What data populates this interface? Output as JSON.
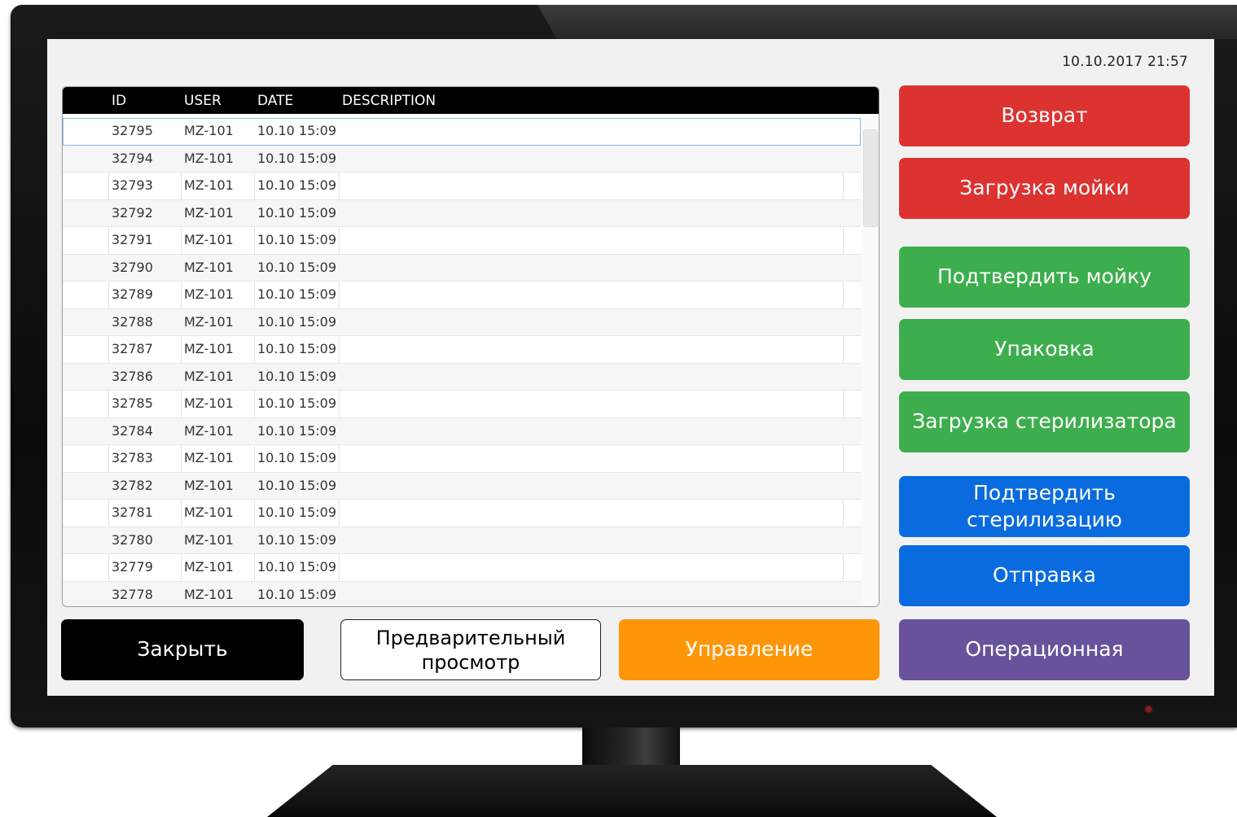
{
  "colors": {
    "return": "#dc3330",
    "green_actions": "#3dae4d",
    "blue_actions": "#0a6be0",
    "operating_room": "#67529b",
    "close": "#000000",
    "management": "#ff960a",
    "preview": "#ffffff"
  },
  "header": {
    "datetime": "10.10.2017 21:57"
  },
  "table": {
    "columns": [
      "ID",
      "USER",
      "DATE",
      "DESCRIPTION"
    ],
    "rows": [
      {
        "id": "32795",
        "user": "MZ-101",
        "date": "10.10 15:09",
        "description": ""
      },
      {
        "id": "32794",
        "user": "MZ-101",
        "date": "10.10 15:09",
        "description": ""
      },
      {
        "id": "32793",
        "user": "MZ-101",
        "date": "10.10 15:09",
        "description": ""
      },
      {
        "id": "32792",
        "user": "MZ-101",
        "date": "10.10 15:09",
        "description": ""
      },
      {
        "id": "32791",
        "user": "MZ-101",
        "date": "10.10 15:09",
        "description": ""
      },
      {
        "id": "32790",
        "user": "MZ-101",
        "date": "10.10 15:09",
        "description": ""
      },
      {
        "id": "32789",
        "user": "MZ-101",
        "date": "10.10 15:09",
        "description": ""
      },
      {
        "id": "32788",
        "user": "MZ-101",
        "date": "10.10 15:09",
        "description": ""
      },
      {
        "id": "32787",
        "user": "MZ-101",
        "date": "10.10 15:09",
        "description": ""
      },
      {
        "id": "32786",
        "user": "MZ-101",
        "date": "10.10 15:09",
        "description": ""
      },
      {
        "id": "32785",
        "user": "MZ-101",
        "date": "10.10 15:09",
        "description": ""
      },
      {
        "id": "32784",
        "user": "MZ-101",
        "date": "10.10 15:09",
        "description": ""
      },
      {
        "id": "32783",
        "user": "MZ-101",
        "date": "10.10 15:09",
        "description": ""
      },
      {
        "id": "32782",
        "user": "MZ-101",
        "date": "10.10 15:09",
        "description": ""
      },
      {
        "id": "32781",
        "user": "MZ-101",
        "date": "10.10 15:09",
        "description": ""
      },
      {
        "id": "32780",
        "user": "MZ-101",
        "date": "10.10 15:09",
        "description": ""
      },
      {
        "id": "32779",
        "user": "MZ-101",
        "date": "10.10 15:09",
        "description": ""
      },
      {
        "id": "32778",
        "user": "MZ-101",
        "date": "10.10 15:09",
        "description": ""
      }
    ]
  },
  "actions": {
    "return": "Возврат",
    "load_washer": "Загрузка мойки",
    "confirm_wash": "Подтвердить мойку",
    "packing": "Упаковка",
    "load_sterilizer": "Загрузка стерилизатора",
    "confirm_sterilization_line1": "Подтвердить",
    "confirm_sterilization_line2": "стерилизацию",
    "dispatch": "Отправка",
    "operating_room": "Операционная"
  },
  "footer": {
    "close": "Закрыть",
    "preview_line1": "Предварительный",
    "preview_line2": "просмотр",
    "management": "Управление"
  }
}
